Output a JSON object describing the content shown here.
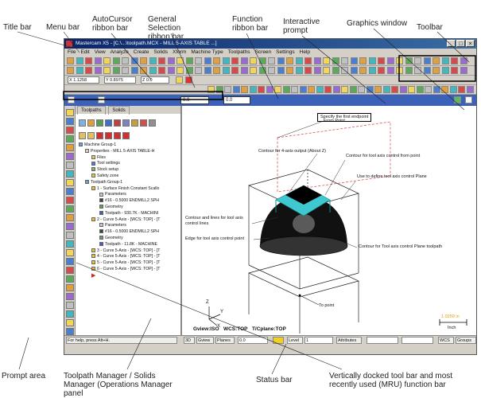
{
  "callouts": {
    "title_bar": "Title bar",
    "menu_bar": "Menu bar",
    "autocursor": "AutoCursor ribbon bar",
    "general_selection": "General Selection ribbon bar",
    "function_ribbon": "Function ribbon bar",
    "interactive_prompt": "Interactive prompt",
    "graphics_window": "Graphics window",
    "toolbar": "Toolbar",
    "prompt_area": "Prompt area",
    "toolpath_manager": "Toolpath Manager / Solids Manager (Operations Manager panel",
    "status_bar": "Status bar",
    "vertical_dock": "Vertically docked tool bar and most recently used (MRU) function bar"
  },
  "window": {
    "title": "Mastercam X5 - [C:\\...\\toolpath.MCX - MILL 5-AXIS TABLE ...]",
    "buttons": [
      "_",
      "□",
      "×"
    ]
  },
  "menu": [
    "File",
    "Edit",
    "View",
    "Analyze",
    "Create",
    "Solids",
    "Xform",
    "Machine Type",
    "Toolpaths",
    "Screen",
    "Settings",
    "Help"
  ],
  "autocursor": {
    "x": "X 1.1258",
    "y": "Y 0.8975",
    "z": "Z 0.0"
  },
  "selection_ribbon": {
    "field1": "0.0",
    "field2": "0.0"
  },
  "manager": {
    "tabs": [
      "Toolpaths",
      "Solids"
    ],
    "tree": [
      "Machine Group-1",
      "Properties - MILL 5-AXIS TABLE-H",
      "Files",
      "Tool settings",
      "Stock setup",
      "Safety zone",
      "Toolpath Group-1",
      "1 - Surface Finish Constant Scallo",
      "Parameters",
      "#16 - 0.5000 ENDMILL2 SPH",
      "Geometry",
      "Toolpath - 930.7K - MACHINI",
      "2 - Curve 5-Axis - [WCS: TOP] - [T",
      "Parameters",
      "#16 - 0.5000 ENDMILL2 SPH",
      "Geometry",
      "Toolpath - 11.8K - MACHINE",
      "3 - Curve 5-Axis - [WCS: TOP] - [T",
      "4 - Curve 5-Axis - [WCS: TOP] - [T",
      "5 - Curve 5-Axis - [WCS: TOP] - [T",
      "6 - Curve 5-Axis - [WCS: TOP] - [T"
    ]
  },
  "graphics": {
    "prompt_text": "Specify the first endpoint",
    "labels": {
      "from_point": "From Point",
      "contour_top": "Contour for 4-axis output (About Z)",
      "contour_from_point": "Contour for tool axis control from point",
      "define_plane": "Use to define tool axis control Plane",
      "contour_lines": "Contour and lines for tool axis control lines",
      "edge_point": "Edge for tool axis control point",
      "plane_toolpath": "Contour for Tool axis control Plane toolpath",
      "to_point": "To point"
    },
    "gview": "Gview:ISO",
    "wcs": "WCS:TOP",
    "tplane": "T/Cplane:TOP",
    "scale_value": "1.0259 in",
    "scale_unit": "Inch",
    "axis_z": "Z",
    "axis_y": "Y",
    "axis_x": "X"
  },
  "status": {
    "prompt": "For help, press Alt+H.",
    "d3": "3D",
    "gview": "Gview",
    "planes": "Planes",
    "z_value": "0.0",
    "level_value": "1",
    "attributes": "Attributes",
    "wcs": "WCS",
    "groups": "Groups",
    "level": "Level"
  }
}
